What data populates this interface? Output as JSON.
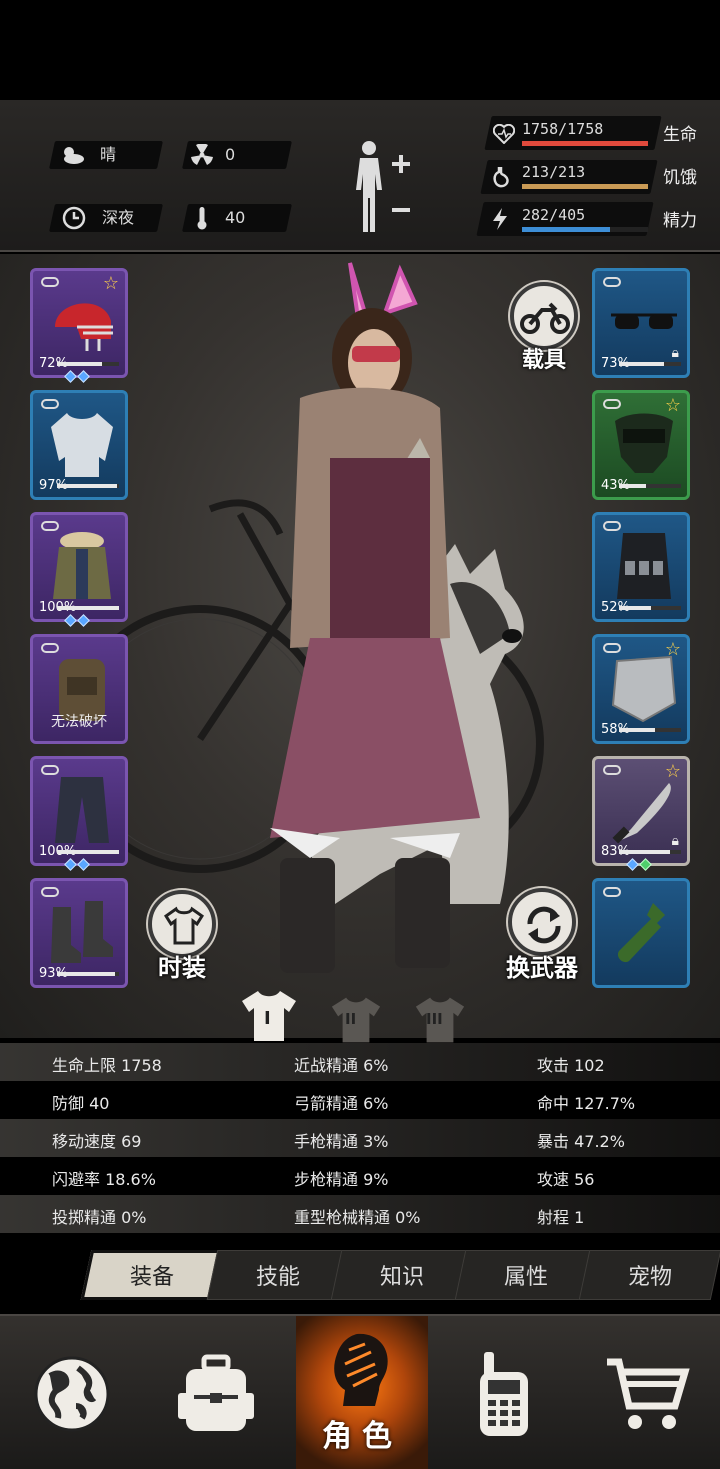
{
  "status": {
    "weather": "晴",
    "radiation": "0",
    "time_of_day": "深夜",
    "temperature": "40",
    "health": {
      "text": "1758/1758",
      "label": "生命",
      "fraction": 1.0,
      "color": "#e04a3c"
    },
    "hunger": {
      "text": "213/213",
      "label": "饥饿",
      "fraction": 1.0,
      "color": "#c99a55"
    },
    "energy": {
      "text": "282/405",
      "label": "精力",
      "fraction": 0.696,
      "color": "#3d8ed6"
    }
  },
  "left_slots": [
    {
      "name": "helmet",
      "icon": "football-helmet-icon",
      "percent": "72%",
      "fraction": 0.72,
      "rarity": "purple",
      "star": true,
      "gems": [
        "blue",
        "blue"
      ]
    },
    {
      "name": "shirt",
      "icon": "shirt-icon",
      "percent": "97%",
      "fraction": 0.97,
      "rarity": "blue",
      "star": false,
      "gems": []
    },
    {
      "name": "jacket",
      "icon": "parka-icon",
      "percent": "100%",
      "fraction": 1.0,
      "rarity": "purple",
      "star": false,
      "gems": [
        "blue",
        "blue"
      ]
    },
    {
      "name": "backpack",
      "icon": "backpack-icon",
      "note": "无法破坏",
      "rarity": "purple",
      "star": false,
      "gems": []
    },
    {
      "name": "pants",
      "icon": "pants-icon",
      "percent": "100%",
      "fraction": 1.0,
      "rarity": "purple",
      "star": false,
      "gems": [
        "blue",
        "blue"
      ]
    },
    {
      "name": "boots",
      "icon": "boots-icon",
      "percent": "93%",
      "fraction": 0.93,
      "rarity": "purple",
      "star": false,
      "gems": []
    }
  ],
  "right_slots": [
    {
      "name": "glasses",
      "icon": "sunglasses-icon",
      "percent": "73%",
      "fraction": 0.73,
      "rarity": "blue",
      "star": false,
      "lock": true,
      "gems": []
    },
    {
      "name": "mask",
      "icon": "gas-mask-icon",
      "percent": "43%",
      "fraction": 0.43,
      "rarity": "green",
      "star": true,
      "lock": false,
      "gems": []
    },
    {
      "name": "vest",
      "icon": "tactical-vest-icon",
      "percent": "52%",
      "fraction": 0.52,
      "rarity": "blue",
      "star": false,
      "lock": false,
      "gems": []
    },
    {
      "name": "shield",
      "icon": "shield-icon",
      "percent": "58%",
      "fraction": 0.58,
      "rarity": "blue",
      "star": true,
      "lock": false,
      "gems": []
    },
    {
      "name": "machete",
      "icon": "machete-icon",
      "percent": "83%",
      "fraction": 0.83,
      "rarity": "gray",
      "star": true,
      "lock": true,
      "gems": [
        "blue",
        "green"
      ]
    },
    {
      "name": "molotov",
      "icon": "bottle-icon",
      "rarity": "blue",
      "star": false,
      "lock": false,
      "gems": []
    }
  ],
  "buttons": {
    "vehicle": "载具",
    "fashion": "时装",
    "switch_weapon": "换武器"
  },
  "outfits": [
    "I",
    "II",
    "III"
  ],
  "stats": [
    [
      "生命上限 1758",
      "近战精通 6%",
      "攻击 102"
    ],
    [
      "防御 40",
      "弓箭精通 6%",
      "命中 127.7%"
    ],
    [
      "移动速度 69",
      "手枪精通 3%",
      "暴击 47.2%"
    ],
    [
      "闪避率 18.6%",
      "步枪精通 9%",
      "攻速 56"
    ],
    [
      "投掷精通 0%",
      "重型枪械精通 0%",
      "射程 1"
    ]
  ],
  "tabs": [
    "装备",
    "技能",
    "知识",
    "属性",
    "宠物"
  ],
  "nav": {
    "items": [
      "globe-icon",
      "backpack-icon",
      "character-icon",
      "radio-icon",
      "cart-icon"
    ],
    "active_label": "角色"
  }
}
